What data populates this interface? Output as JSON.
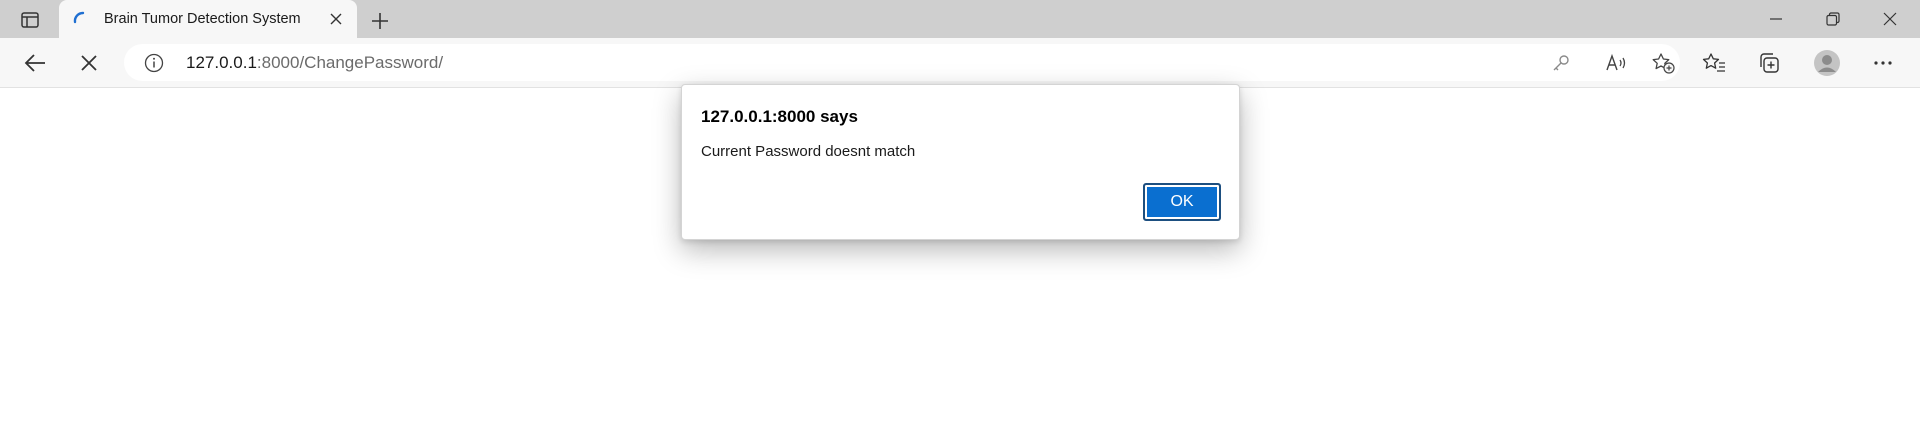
{
  "browser": {
    "tab": {
      "title": "Brain Tumor Detection System",
      "favicon": "loading-spinner-icon"
    },
    "address": {
      "host": "127.0.0.1",
      "rest": ":8000/ChangePassword/"
    }
  },
  "dialog": {
    "title": "127.0.0.1:8000 says",
    "message": "Current Password doesnt match",
    "ok_label": "OK"
  },
  "colors": {
    "accent": "#0a6fd0",
    "tabstrip": "#cfcfcf",
    "toolbar": "#f7f7f7"
  }
}
